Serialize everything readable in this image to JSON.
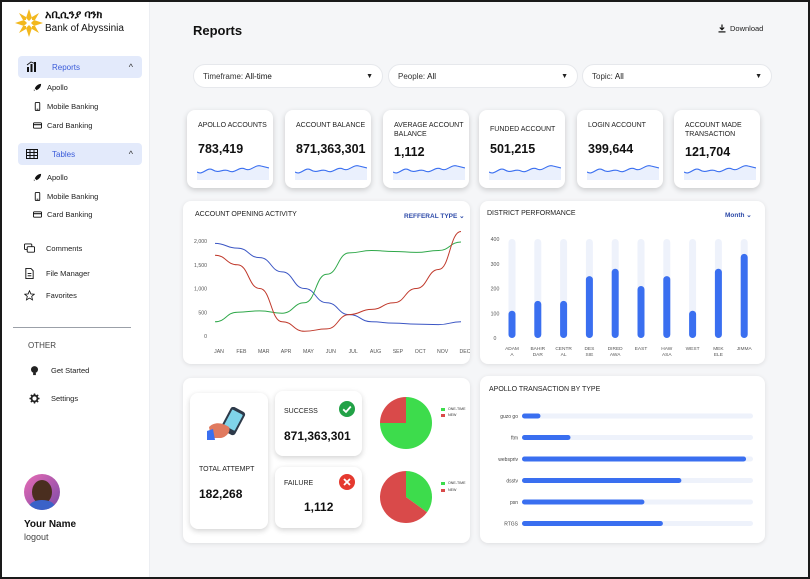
{
  "brand": {
    "amharic": "አቢሲንያ ባንክ",
    "english": "Bank of Abyssinia"
  },
  "sidebar": {
    "reports": {
      "label": "Reports",
      "items": [
        "Apollo",
        "Mobile Banking",
        "Card Banking"
      ]
    },
    "tables": {
      "label": "Tables",
      "items": [
        "Apollo",
        "Mobile Banking",
        "Card Banking"
      ]
    },
    "links": [
      "Comments",
      "File Manager",
      "Favorites"
    ],
    "other_label": "OTHER",
    "other": [
      "Get Started",
      "Settings"
    ],
    "user": {
      "name": "Your Name",
      "logout": "logout"
    }
  },
  "header": {
    "title": "Reports",
    "download": "Download"
  },
  "filters": [
    {
      "label": "Timeframe:",
      "value": "All-time"
    },
    {
      "label": "People:",
      "value": "All"
    },
    {
      "label": "Topic:",
      "value": "All"
    }
  ],
  "kpis": [
    {
      "label": "APOLLO ACCOUNTS",
      "value": "783,419"
    },
    {
      "label": "ACCOUNT BALANCE",
      "value": "871,363,301"
    },
    {
      "label": "AVERAGE ACCOUNT BALANCE",
      "value": "1,112"
    },
    {
      "label": "FUNDED ACCOUNT",
      "value": "501,215"
    },
    {
      "label": "LOGIN ACCOUNT",
      "value": "399,644"
    },
    {
      "label": "ACCOUNT MADE TRANSACTION",
      "value": "121,704"
    }
  ],
  "colors": {
    "accent": "#3a6ff0",
    "green": "#2fbf4a",
    "red": "#e04848",
    "blue_line": "#3b56c4"
  },
  "chart_data": [
    {
      "type": "line",
      "title": "ACCOUNT OPENING ACTIVITY",
      "filter": "REFFERAL TYPE",
      "categories": [
        "JAN",
        "FEB",
        "MAR",
        "APR",
        "MAY",
        "JUN",
        "JUL",
        "AUG",
        "SEP",
        "OCT",
        "NOV",
        "DEC"
      ],
      "y_ticks": [
        "2,000",
        "1,500",
        "1,000",
        "500",
        "0"
      ],
      "ylim": [
        0,
        2000
      ],
      "series": [
        {
          "color": "#3b56c4",
          "values": [
            1950,
            1850,
            1650,
            1350,
            1000,
            700,
            450,
            300,
            270,
            250,
            240,
            300
          ]
        },
        {
          "color": "#2fa84a",
          "values": [
            300,
            500,
            530,
            480,
            700,
            1300,
            1750,
            1800,
            1780,
            1760,
            1800,
            1980
          ]
        },
        {
          "color": "#c0392b",
          "values": [
            1700,
            1500,
            1000,
            300,
            100,
            150,
            450,
            560,
            700,
            1000,
            1400,
            2200
          ]
        }
      ]
    },
    {
      "type": "bar",
      "title": "DISTRICT PERFORMANCE",
      "filter": "Month",
      "categories": [
        "ADAM A",
        "BAHIR DAR",
        "CENTR AL",
        "DES SIE",
        "DIRED AWA",
        "EAST",
        "HAW ASA",
        "WEST",
        "MEK ELE",
        "JIMMA"
      ],
      "y_ticks": [
        "400",
        "300",
        "200",
        "100",
        "0"
      ],
      "ylim": [
        0,
        400
      ],
      "values": [
        110,
        150,
        150,
        250,
        280,
        210,
        250,
        110,
        280,
        340
      ]
    },
    {
      "type": "bar",
      "title": "APOLLO TRANSACTION BY TYPE",
      "categories": [
        "guzo go",
        "ftm",
        "webspriv",
        "dsstv",
        "psn",
        "RTGS"
      ],
      "values": [
        0.08,
        0.21,
        0.97,
        0.69,
        0.53,
        0.61
      ]
    },
    {
      "type": "pie",
      "title": "",
      "slices": [
        {
          "name": "ONE-TIME",
          "value": 75,
          "color": "#3ddc4c"
        },
        {
          "name": "NEW",
          "value": 25,
          "color": "#d94a4a"
        }
      ]
    },
    {
      "type": "pie",
      "title": "",
      "slices": [
        {
          "name": "ONE-TIME",
          "value": 35,
          "color": "#3ddc4c"
        },
        {
          "name": "NEW",
          "value": 65,
          "color": "#d94a4a"
        }
      ]
    }
  ],
  "attempts": {
    "total_label": "TOTAL ATTEMPT",
    "total_value": "182,268",
    "success_label": "SUCCESS",
    "success_value": "871,363,301",
    "failure_label": "FAILURE",
    "failure_value": "1,112"
  }
}
